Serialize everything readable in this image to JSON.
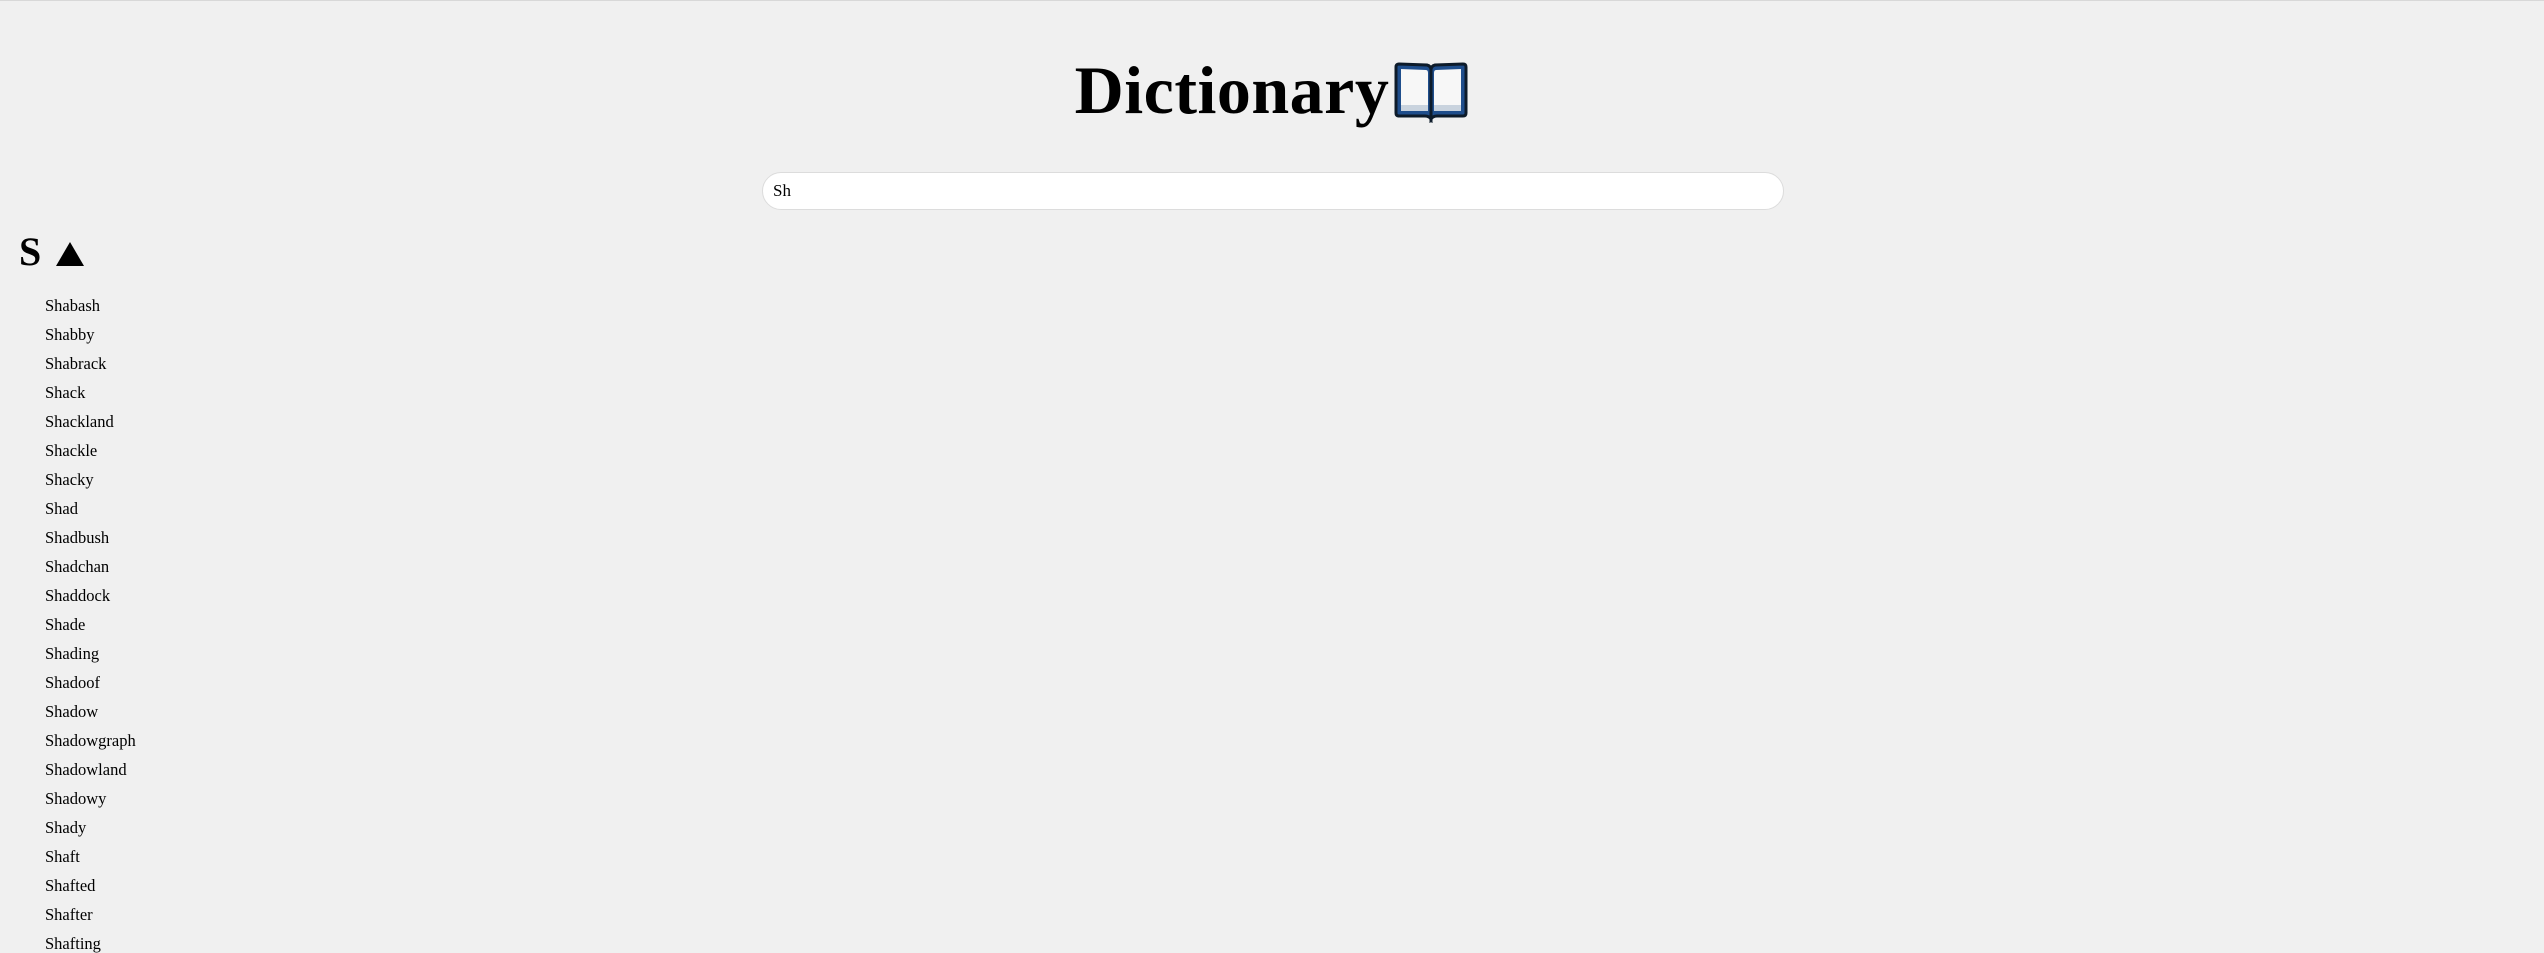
{
  "header": {
    "title": "Dictionary",
    "icon": "open-book-icon"
  },
  "search": {
    "value": "Sh",
    "placeholder": ""
  },
  "section": {
    "letter": "S",
    "toggle_icon": "triangle-up-icon",
    "expanded": true
  },
  "words": [
    "Shabash",
    "Shabby",
    "Shabrack",
    "Shack",
    "Shackland",
    "Shackle",
    "Shacky",
    "Shad",
    "Shadbush",
    "Shadchan",
    "Shaddock",
    "Shade",
    "Shading",
    "Shadoof",
    "Shadow",
    "Shadowgraph",
    "Shadowland",
    "Shadowy",
    "Shady",
    "Shaft",
    "Shafted",
    "Shafter",
    "Shafting"
  ],
  "colors": {
    "background": "#f0f0f0",
    "search_bg": "#ffffff",
    "search_border": "#dcdcdc",
    "book_blue": "#1f4e8c",
    "text": "#000000"
  }
}
